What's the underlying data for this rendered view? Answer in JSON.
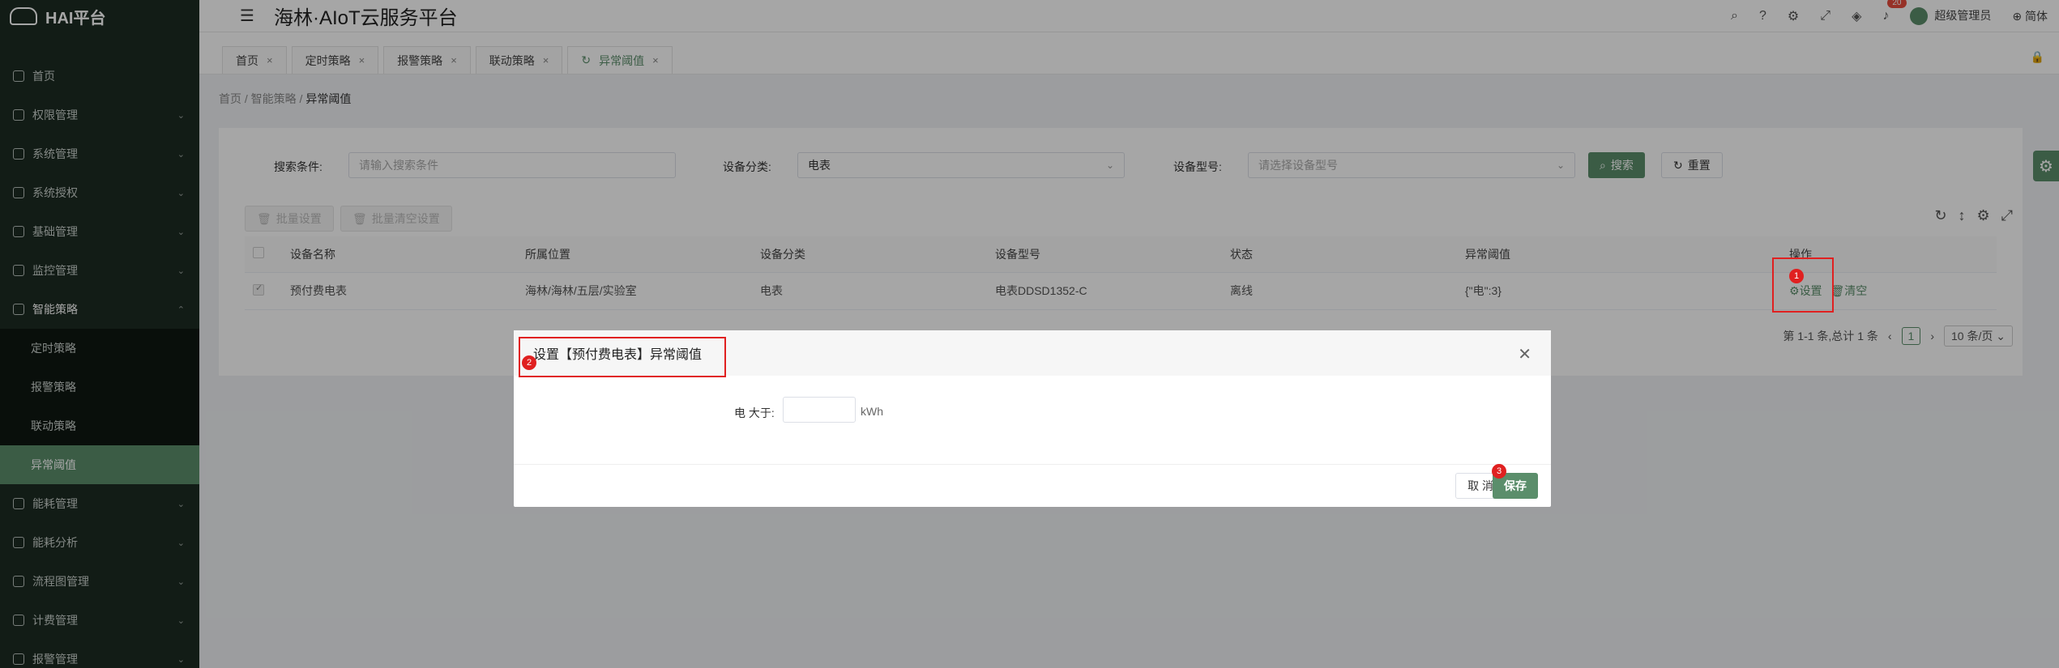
{
  "app": {
    "logo": "HAI平台",
    "title": "海林·AIoT云服务平台"
  },
  "header": {
    "notification_count": "20",
    "user": "超级管理员",
    "language": "简体"
  },
  "sidebar": {
    "items": [
      {
        "label": "首页"
      },
      {
        "label": "权限管理"
      },
      {
        "label": "系统管理"
      },
      {
        "label": "系统授权"
      },
      {
        "label": "基础管理"
      },
      {
        "label": "监控管理"
      },
      {
        "label": "智能策略"
      },
      {
        "label": "能耗管理"
      },
      {
        "label": "能耗分析"
      },
      {
        "label": "流程图管理"
      },
      {
        "label": "计费管理"
      },
      {
        "label": "报警管理"
      }
    ],
    "submenu": [
      {
        "label": "定时策略"
      },
      {
        "label": "报警策略"
      },
      {
        "label": "联动策略"
      },
      {
        "label": "异常阈值"
      }
    ]
  },
  "tabs": [
    {
      "label": "首页"
    },
    {
      "label": "定时策略"
    },
    {
      "label": "报警策略"
    },
    {
      "label": "联动策略"
    },
    {
      "label": "异常阈值"
    }
  ],
  "breadcrumb": {
    "a": "首页",
    "b": "智能策略",
    "c": "异常阈值"
  },
  "search": {
    "cond_label": "搜索条件:",
    "cond_placeholder": "请输入搜索条件",
    "cat_label": "设备分类:",
    "cat_value": "电表",
    "model_label": "设备型号:",
    "model_placeholder": "请选择设备型号",
    "search_btn": "搜索",
    "reset_btn": "重置"
  },
  "batch": {
    "set": "批量设置",
    "clear": "批量清空设置"
  },
  "table": {
    "headers": [
      "设备名称",
      "所属位置",
      "设备分类",
      "设备型号",
      "状态",
      "异常阈值",
      "操作"
    ],
    "rows": [
      {
        "name": "预付费电表",
        "location": "海林/海林/五层/实验室",
        "category": "电表",
        "model": "电表DDSD1352-C",
        "status": "离线",
        "threshold": "{\"电\":3}",
        "op_set": "设置",
        "op_clear": "清空"
      }
    ]
  },
  "pager": {
    "summary": "第 1-1 条,总计 1 条",
    "current": "1",
    "size": "10 条/页"
  },
  "modal": {
    "title": "设置【预付费电表】异常阈值",
    "field_label": "电 大于:",
    "field_unit": "kWh",
    "cancel": "取 消",
    "save": "保存"
  },
  "steps": [
    "1",
    "2",
    "3"
  ]
}
